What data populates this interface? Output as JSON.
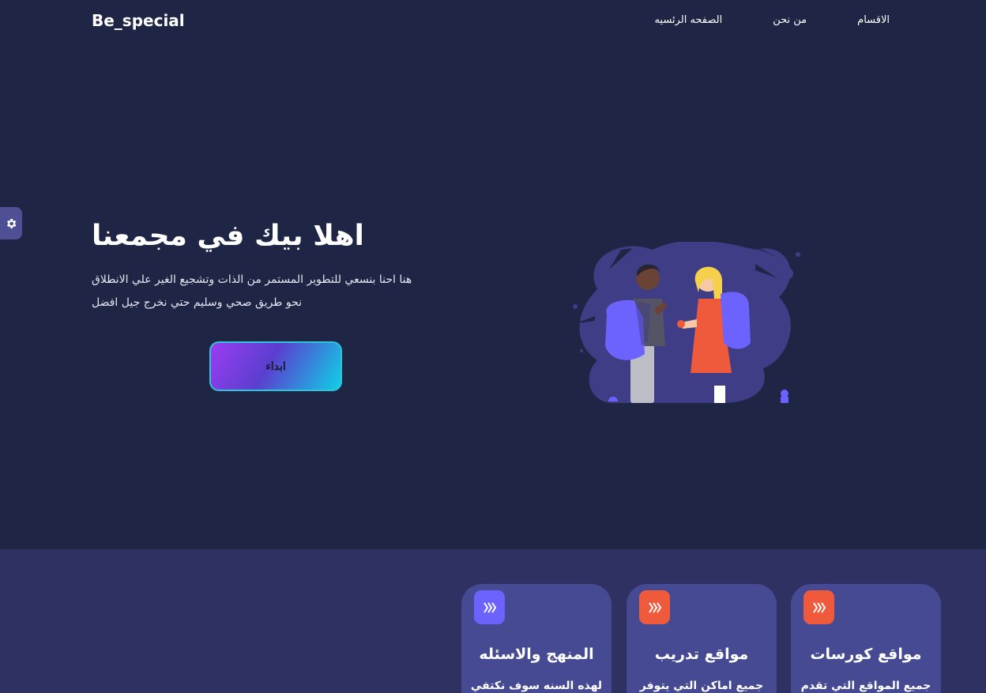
{
  "header": {
    "brand": "Be_special",
    "nav": [
      {
        "label": "الاقسام"
      },
      {
        "label": "من نحن"
      },
      {
        "label": "الصفحه الرئسيه"
      }
    ]
  },
  "settings": {
    "icon": "gear-icon"
  },
  "hero": {
    "title": "اهلا بيك في مجمعنا",
    "text_line1": "هنا احنا بنسعي للتطوير المستمر من الذات وتشجيع الغير علي الانطلاق",
    "text_line2": "نحو طريق صحي وسليم حتي نخرج جيل افضل",
    "button_label": "ابداء"
  },
  "colors": {
    "background": "#1f2544",
    "lower_section": "#2f3163",
    "card": "#454a92",
    "accent_orange": "#f05a3c",
    "accent_purple": "#6c63ff"
  },
  "cards": [
    {
      "title": "مواقع كورسات",
      "text": "جميع المواقع التي تقدم",
      "icon": "hive-icon",
      "badge_color": "#f05a3c"
    },
    {
      "title": "مواقع تدريب",
      "text": "جميع اماكن التي يتوفر",
      "icon": "hive-icon",
      "badge_color": "#f05a3c"
    },
    {
      "title": "المنهج والاسئله",
      "text": "لهذه السنه سوف نكتفي",
      "icon": "hive-icon",
      "badge_color": "#6c63ff"
    }
  ]
}
